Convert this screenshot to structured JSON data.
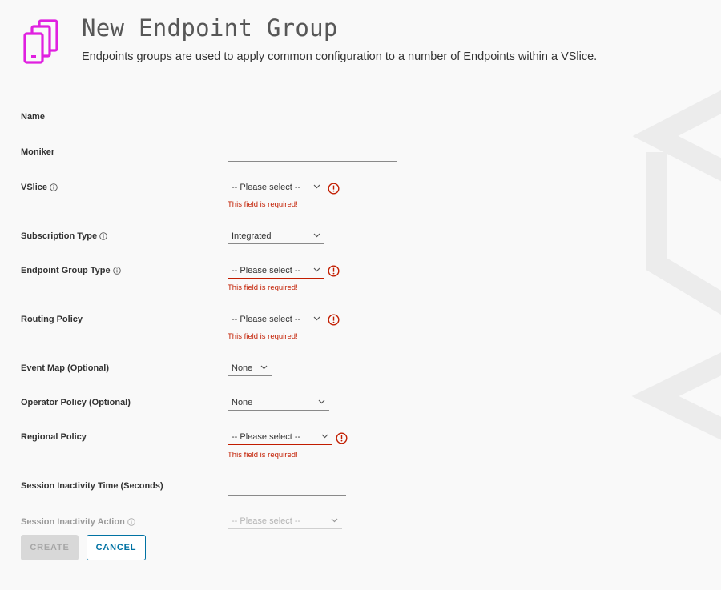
{
  "header": {
    "title": "New Endpoint Group",
    "subtitle": "Endpoints groups are used to apply common configuration to a number of Endpoints within a VSlice."
  },
  "colors": {
    "brand": "#e020e0",
    "error": "#c21d00",
    "primary": "#0072a3"
  },
  "form": {
    "name": {
      "label": "Name",
      "value": ""
    },
    "moniker": {
      "label": "Moniker",
      "value": ""
    },
    "vslice": {
      "label": "VSlice",
      "value": "-- Please select --",
      "error": "This field is required!"
    },
    "subscription_type": {
      "label": "Subscription Type",
      "value": "Integrated"
    },
    "endpoint_group_type": {
      "label": "Endpoint Group Type",
      "value": "-- Please select --",
      "error": "This field is required!"
    },
    "routing_policy": {
      "label": "Routing Policy",
      "value": "-- Please select --",
      "error": "This field is required!"
    },
    "event_map": {
      "label": "Event Map (Optional)",
      "value": "None"
    },
    "operator_policy": {
      "label": "Operator Policy (Optional)",
      "value": "None"
    },
    "regional_policy": {
      "label": "Regional Policy",
      "value": "-- Please select --",
      "error": "This field is required!"
    },
    "session_inactivity_time": {
      "label": "Session Inactivity Time (Seconds)",
      "value": ""
    },
    "session_inactivity_action": {
      "label": "Session Inactivity Action",
      "value": "-- Please select --"
    }
  },
  "buttons": {
    "create": "CREATE",
    "cancel": "CANCEL"
  }
}
